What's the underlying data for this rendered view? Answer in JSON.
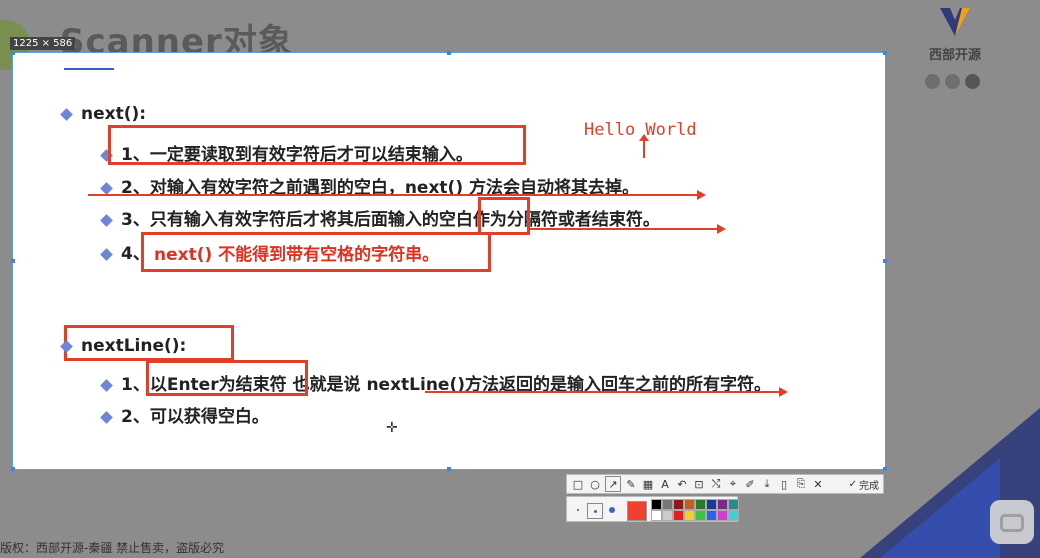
{
  "slide_title": "Scanner对象",
  "dim_label": "1225 × 586",
  "logo": {
    "text": "西部开源"
  },
  "sections": {
    "next": {
      "heading": "next():",
      "items": [
        "1、一定要读取到有效字符后才可以结束输入。",
        "2、对输入有效字符之前遇到的空白，next() 方法会自动将其去掉。",
        "3、只有输入有效字符后才将其后面输入的空白作为分隔符或者结束符。"
      ],
      "item4_num": "4、",
      "item4_text": "next() 不能得到带有空格的字符串。"
    },
    "nextline": {
      "heading": "nextLine():",
      "item1_num": "1、",
      "item1_box": "以Enter为结束符",
      "item1_rest": " 也就是说 nextLine()方法返回的是输入回车之前的所有字符。",
      "item2": "2、可以获得空白。"
    }
  },
  "annotation": {
    "text": "Hello World"
  },
  "toolbar": {
    "done_label": "完成"
  },
  "footer": {
    "text": "版权：西部开源-秦疆    禁止售卖，盗版必究"
  },
  "colors": {
    "accent_red": "#e0402a",
    "diamond": "#6f86d6",
    "current_color": "#f04030"
  }
}
